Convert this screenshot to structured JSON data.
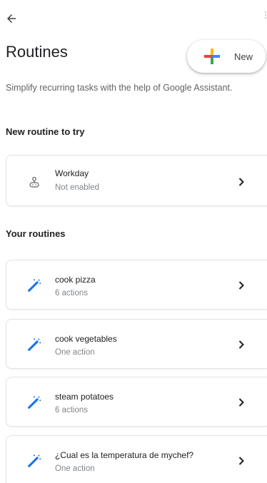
{
  "header": {
    "back_icon": "arrow-left-icon",
    "title": "Routines",
    "new_button": {
      "label": "New",
      "icon": "google-plus-icon"
    },
    "subtitle": "Simplify recurring tasks with the help of Google Assistant."
  },
  "sections": {
    "suggested_title": "New routine to try",
    "yours_title": "Your routines"
  },
  "suggested": {
    "name": "Workday",
    "status": "Not enabled",
    "icon": "workday-icon"
  },
  "routines": [
    {
      "name": "cook pizza",
      "status": "6 actions",
      "icon": "magic-wand-icon"
    },
    {
      "name": "cook vegetables",
      "status": "One action",
      "icon": "magic-wand-icon"
    },
    {
      "name": "steam potatoes",
      "status": "6 actions",
      "icon": "magic-wand-icon"
    },
    {
      "name": "¿Cual es la temperatura de mychef?",
      "status": "One action",
      "icon": "magic-wand-icon"
    }
  ],
  "colors": {
    "google_red": "#ea4335",
    "google_blue": "#4285f4",
    "google_yellow": "#fbbc05",
    "google_green": "#34a853",
    "wand_blue": "#1a73e8"
  }
}
